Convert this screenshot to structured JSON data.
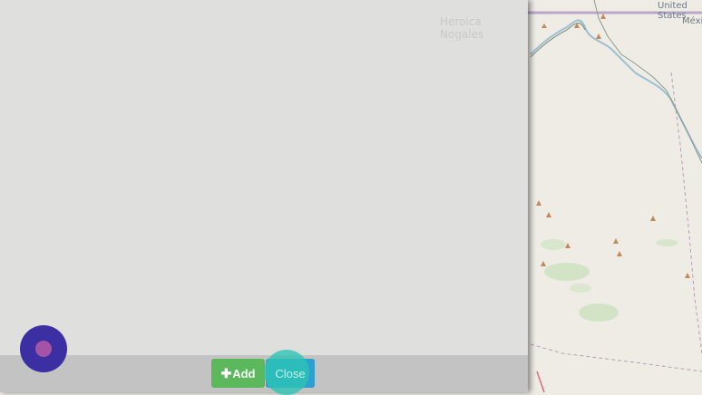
{
  "map": {
    "labels": [
      "United States",
      "México",
      "Heroica Nogales"
    ]
  },
  "toolbar": {
    "add_label": "Add",
    "close_label": "Close"
  },
  "colors": {
    "add_button": "#5cb85c",
    "close_button": "#2e9fcf",
    "fab": "#3b2fa3",
    "fab_dot": "#a553a6"
  },
  "icons": {
    "add": "plus-icon",
    "peak": "triangle-icon"
  }
}
